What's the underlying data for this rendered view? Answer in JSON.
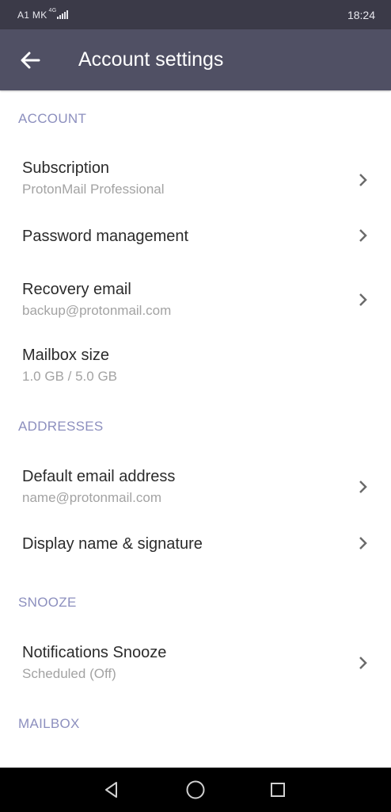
{
  "status_bar": {
    "carrier": "A1 MK",
    "network": "4G",
    "time": "18:24"
  },
  "header": {
    "title": "Account settings",
    "back_icon": "arrow-left-icon"
  },
  "sections": {
    "account": {
      "label": "ACCOUNT",
      "items": [
        {
          "title": "Subscription",
          "subtitle": "ProtonMail Professional"
        },
        {
          "title": "Password management"
        },
        {
          "title": "Recovery email",
          "subtitle": "backup@protonmail.com"
        },
        {
          "title": "Mailbox size",
          "subtitle": "1.0 GB / 5.0 GB"
        }
      ]
    },
    "addresses": {
      "label": "ADDRESSES",
      "items": [
        {
          "title": "Default email address",
          "subtitle": "name@protonmail.com"
        },
        {
          "title": "Display name & signature"
        }
      ]
    },
    "snooze": {
      "label": "SNOOZE",
      "items": [
        {
          "title": "Notifications Snooze",
          "subtitle": "Scheduled (Off)"
        }
      ]
    },
    "mailbox": {
      "label": "MAILBOX"
    }
  },
  "nav_bar": {
    "back_icon": "triangle-back-icon",
    "home_icon": "circle-home-icon",
    "recents_icon": "square-recents-icon"
  },
  "colors": {
    "status_bar": "#3b3a48",
    "app_bar": "#505064",
    "section_header": "#8c8fbe",
    "primary_text": "#2b2b2b",
    "secondary_text": "#a3a3a3",
    "chevron": "#6b6b6b"
  }
}
